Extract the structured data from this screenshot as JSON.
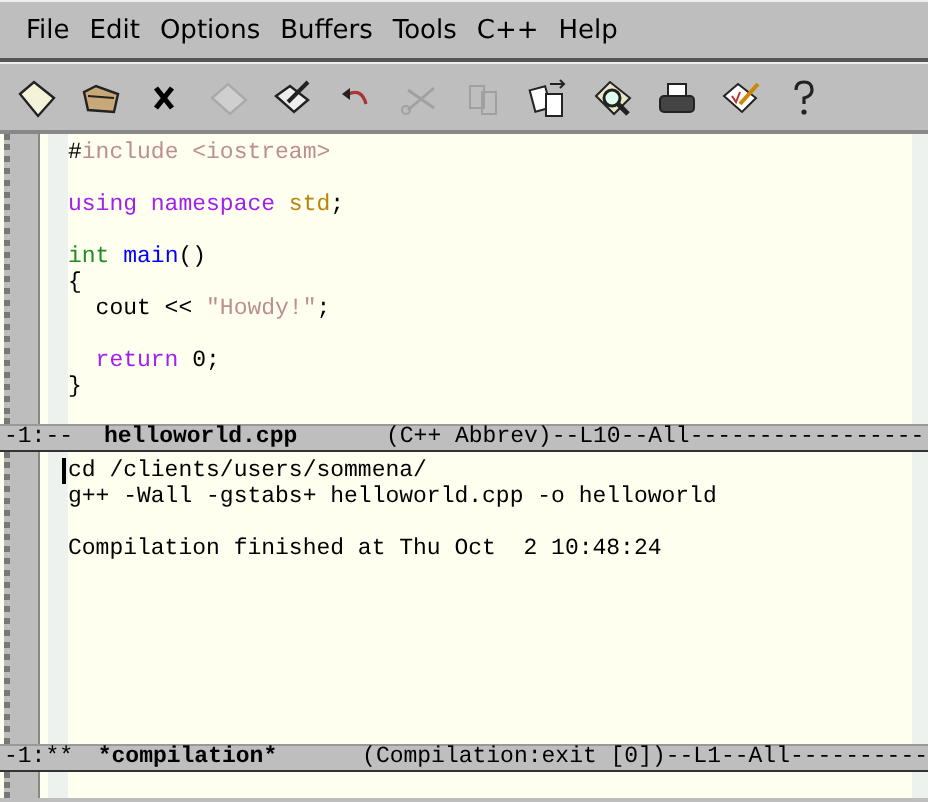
{
  "menu_bar": [
    "File",
    "Edit",
    "Options",
    "Buffers",
    "Tools",
    "C++",
    "Help"
  ],
  "toolbar": [
    {
      "kind": "new",
      "disabled": false
    },
    {
      "kind": "open",
      "disabled": false
    },
    {
      "kind": "close",
      "disabled": false
    },
    {
      "kind": "save",
      "disabled": true
    },
    {
      "kind": "edit",
      "disabled": false
    },
    {
      "kind": "undo",
      "disabled": false
    },
    {
      "kind": "cut",
      "disabled": true
    },
    {
      "kind": "paste",
      "disabled": true
    },
    {
      "kind": "replace",
      "disabled": false
    },
    {
      "kind": "search",
      "disabled": false
    },
    {
      "kind": "print",
      "disabled": false
    },
    {
      "kind": "spell",
      "disabled": false
    },
    {
      "kind": "help",
      "disabled": false
    }
  ],
  "editor": {
    "lines": [
      {
        "kind": "code",
        "tokens": [
          {
            "kind": "plain",
            "text": "#"
          },
          {
            "kind": "preprocessor",
            "text": "include <iostream>"
          }
        ]
      },
      {
        "kind": "blank"
      },
      {
        "kind": "code",
        "tokens": [
          {
            "kind": "keyword",
            "text": "using namespace"
          },
          {
            "kind": "constant",
            "text": " std"
          },
          {
            "kind": "plain",
            "text": ";"
          }
        ]
      },
      {
        "kind": "blank"
      },
      {
        "kind": "code",
        "tokens": [
          {
            "kind": "type",
            "text": "int"
          },
          {
            "kind": "function",
            "text": " main"
          },
          {
            "kind": "plain",
            "text": "()"
          }
        ]
      },
      {
        "kind": "code",
        "tokens": [
          {
            "kind": "plain",
            "text": "{"
          }
        ]
      },
      {
        "kind": "code",
        "tokens": [
          {
            "kind": "plain",
            "text": "  cout << "
          },
          {
            "kind": "string",
            "text": "\"Howdy!\""
          },
          {
            "kind": "plain",
            "text": ";"
          }
        ]
      },
      {
        "kind": "blank"
      },
      {
        "kind": "code",
        "tokens": [
          {
            "kind": "keyword",
            "text": "  return"
          },
          {
            "kind": "plain",
            "text": " 0;"
          }
        ]
      },
      {
        "kind": "code",
        "tokens": [
          {
            "kind": "plain",
            "text": "}"
          }
        ]
      }
    ],
    "mode_line": {
      "status": "-1:--",
      "buffer": "helloworld.cpp",
      "info": "(C++ Abbrev)--L10--All-----------------"
    }
  },
  "compilation": {
    "lines": [
      {
        "kind": "text",
        "text": "cd /clients/users/sommena/",
        "cursor": true
      },
      {
        "kind": "text",
        "text": "g++ -Wall -gstabs+ helloworld.cpp -o helloworld",
        "cursor": false
      },
      {
        "kind": "blank"
      },
      {
        "kind": "text",
        "text": "Compilation finished at Thu Oct  2 10:48:24",
        "cursor": false
      }
    ],
    "mode_line": {
      "status": "-1:**",
      "buffer": "*compilation*",
      "info": "(Compilation:exit [0])--L1--All----------"
    }
  }
}
